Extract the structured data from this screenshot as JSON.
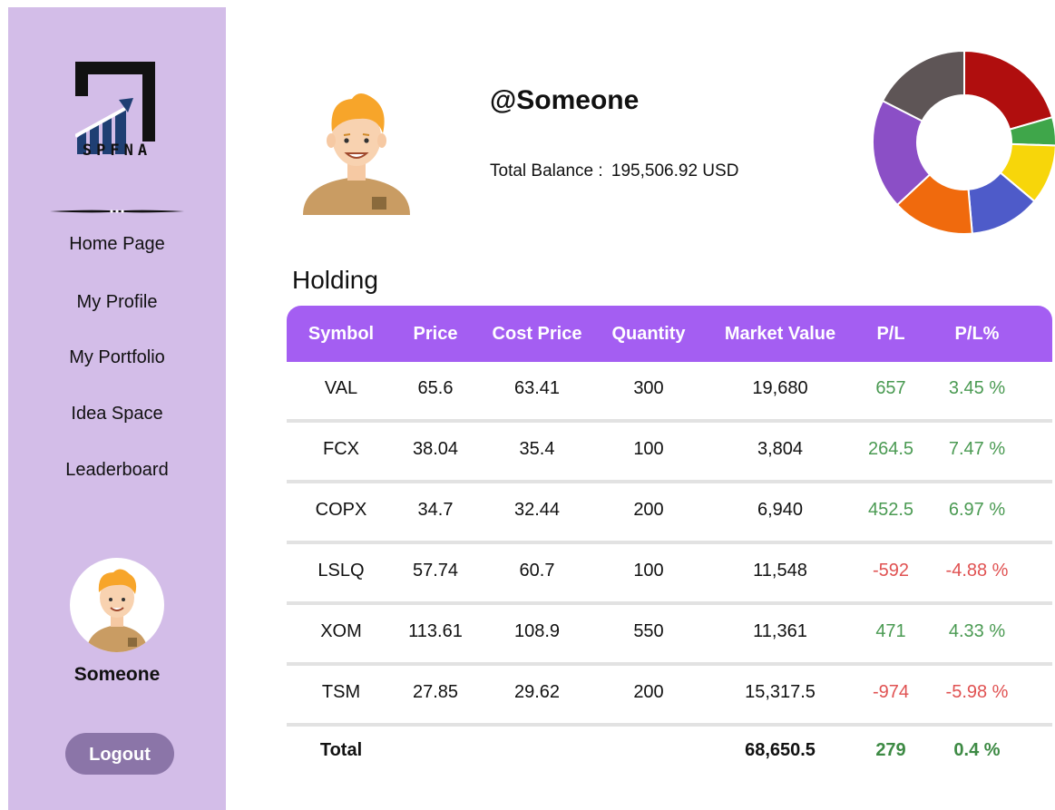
{
  "sidebar": {
    "logo_text": "SPFNA",
    "nav": [
      {
        "label": "Home Page"
      },
      {
        "label": "My Profile"
      },
      {
        "label": "My Portfolio"
      },
      {
        "label": "Idea Space"
      },
      {
        "label": "Leaderboard"
      }
    ],
    "user_name": "Someone",
    "logout_label": "Logout"
  },
  "profile": {
    "handle": "@Someone",
    "balance_label": "Total Balance :",
    "balance_value": "195,506.92 USD"
  },
  "donut_colors": [
    "#b00e0e",
    "#3fa64a",
    "#f7d60a",
    "#4e5bc9",
    "#f06a0d",
    "#8b4fc6",
    "#5e5556"
  ],
  "holding": {
    "title": "Holding",
    "columns": [
      "Symbol",
      "Price",
      "Cost Price",
      "Quantity",
      "Market Value",
      "P/L",
      "P/L%"
    ],
    "rows": [
      {
        "symbol": "VAL",
        "price": "65.6",
        "cost": "63.41",
        "qty": "300",
        "mv": "19,680",
        "pl": "657",
        "plp": "3.45 %",
        "sign": "pos"
      },
      {
        "symbol": "FCX",
        "price": "38.04",
        "cost": "35.4",
        "qty": "100",
        "mv": "3,804",
        "pl": "264.5",
        "plp": "7.47 %",
        "sign": "pos"
      },
      {
        "symbol": "COPX",
        "price": "34.7",
        "cost": "32.44",
        "qty": "200",
        "mv": "6,940",
        "pl": "452.5",
        "plp": "6.97 %",
        "sign": "pos"
      },
      {
        "symbol": "LSLQ",
        "price": "57.74",
        "cost": "60.7",
        "qty": "100",
        "mv": "11,548",
        "pl": "-592",
        "plp": "-4.88 %",
        "sign": "neg"
      },
      {
        "symbol": "XOM",
        "price": "113.61",
        "cost": "108.9",
        "qty": "550",
        "mv": "11,361",
        "pl": "471",
        "plp": "4.33 %",
        "sign": "pos"
      },
      {
        "symbol": "TSM",
        "price": "27.85",
        "cost": "29.62",
        "qty": "200",
        "mv": "15,317.5",
        "pl": "-974",
        "plp": "-5.98 %",
        "sign": "neg"
      }
    ],
    "total": {
      "label": "Total",
      "mv": "68,650.5",
      "pl": "279",
      "plp": "0.4 %"
    }
  }
}
